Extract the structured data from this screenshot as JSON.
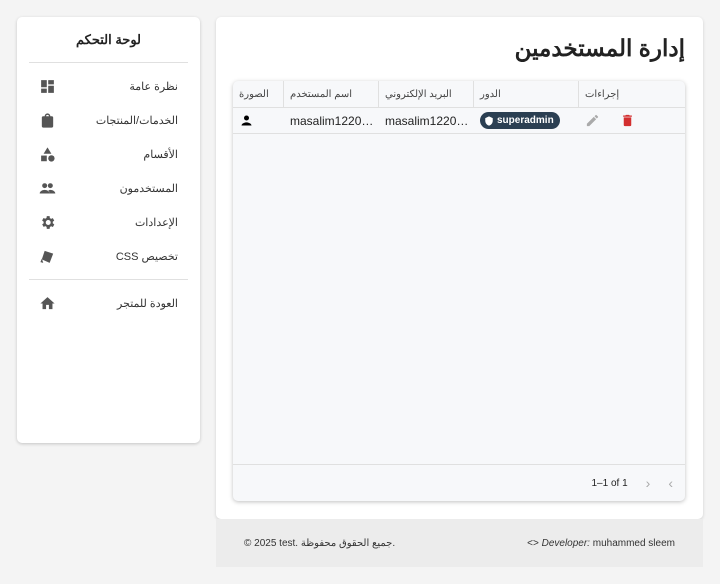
{
  "sidebar": {
    "title": "لوحة التحكم",
    "items": [
      {
        "label": "نظرة عامة",
        "icon": "dashboard-icon"
      },
      {
        "label": "الخدمات/المنتجات",
        "icon": "shopping-bag-icon"
      },
      {
        "label": "الأقسام",
        "icon": "category-icon"
      },
      {
        "label": "المستخدمون",
        "icon": "people-icon"
      },
      {
        "label": "الإعدادات",
        "icon": "gear-icon"
      },
      {
        "label": "تخصيص CSS",
        "icon": "style-icon"
      }
    ],
    "back": {
      "label": "العودة للمتجر",
      "icon": "home-icon"
    }
  },
  "main": {
    "title": "إدارة المستخدمين",
    "columns": [
      "الصورة",
      "اسم المستخدم",
      "البريد الإلكتروني",
      "الدور",
      "إجراءات"
    ],
    "rows": [
      {
        "username": "masalim1220…",
        "email": "masalim1220…",
        "role": "superadmin"
      }
    ],
    "pagination": "1–1 of 1"
  },
  "footer": {
    "copyright": "© 2025 test. جميع الحقوق محفوظة.",
    "dev_label": "Developer:",
    "dev_name": "muhammed sleem"
  },
  "colors": {
    "badge": "#2b3f52",
    "delete": "#d32f2f"
  }
}
